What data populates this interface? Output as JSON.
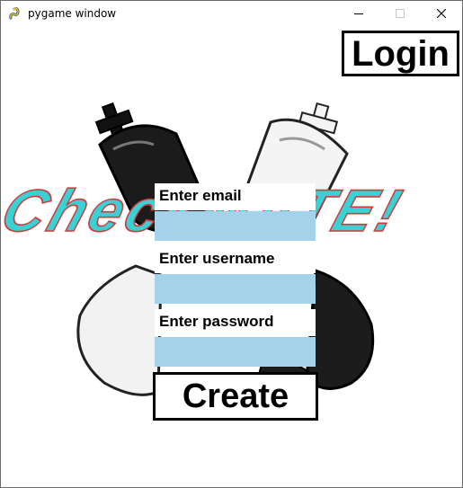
{
  "window": {
    "title": "pygame window",
    "icon": "pygame-snake-icon",
    "controls": [
      "minimize-icon",
      "maximize-icon",
      "close-icon"
    ]
  },
  "logo": {
    "text": "CheckMATE!",
    "fill_color": "#3ad1d5",
    "outline_color": "#d23a3a"
  },
  "login": {
    "label": "Login"
  },
  "form": {
    "email": {
      "label": "Enter email",
      "value": ""
    },
    "username": {
      "label": "Enter username",
      "value": ""
    },
    "password": {
      "label": "Enter password",
      "value": ""
    }
  },
  "create": {
    "label": "Create"
  },
  "colors": {
    "input_background": "#a4d2ea",
    "button_border": "#000000",
    "background": "#ffffff"
  }
}
